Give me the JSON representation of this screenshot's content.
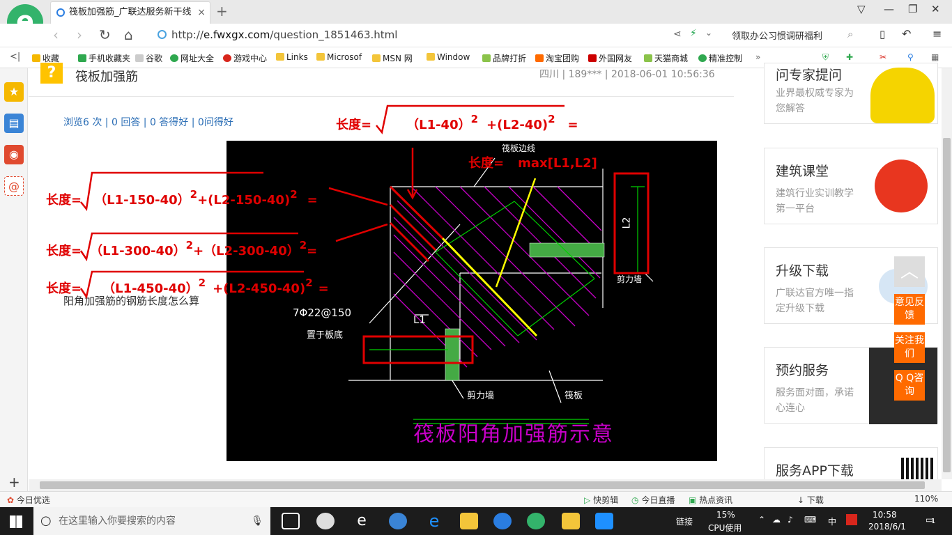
{
  "browser": {
    "tab_title": "筏板加强筋_广联达服务新干线",
    "url_scheme": "http://",
    "url_host": "e.fwxgx.com",
    "url_path": "/question_1851463.html",
    "promo_text": "领取办公习惯调研福利",
    "bookmarks": [
      "收藏",
      "手机收藏夹",
      "谷歌",
      "网址大全",
      "游戏中心",
      "Links",
      "Microsof",
      "MSN 网",
      "Window",
      "品牌打折",
      "淘宝团购",
      "外国网友",
      "天猫商城",
      "精准控制"
    ]
  },
  "page": {
    "title": "筏板加强筋",
    "meta": "四川 | 189*** | 2018-06-01 10:56:36",
    "stats": "浏览6 次 | 0 回答 | 0 答得好 | 0问得好",
    "question_text": "阳角加强筋的钢筋长度怎么算"
  },
  "annotations": {
    "len": "长度=",
    "f1": "（L1-40）",
    "f1b": "+(L2-40)",
    "eq": "=",
    "f2": "（L1-150-40）",
    "f2b": "+(L2-150-40)",
    "f3": "（L1-300-40）",
    "f3b": "+（L2-300-40）",
    "f4": "（L1-450-40）",
    "f4b": "+(L2-450-40)",
    "sq": "2",
    "max": "max[L1,L2]"
  },
  "drawing": {
    "raft_edge": "筏板边线",
    "rebar": "7Φ22@150",
    "bottom": "置于板底",
    "shear_wall": "剪力墙",
    "raft": "筏板",
    "l1": "L1",
    "l2": "L2",
    "caption": "筏板阳角加强筋示意"
  },
  "sidebar_cards": [
    {
      "title": "问专家提问",
      "sub": "业界最权威专家为您解答"
    },
    {
      "title": "建筑课堂",
      "sub": "建筑行业实训教学第一平台"
    },
    {
      "title": "升级下载",
      "sub": "广联达官方唯一指定升级下载"
    },
    {
      "title": "预约服务",
      "sub": "服务面对面，承诺心连心"
    },
    {
      "title": "服务APP下载",
      "sub": ""
    }
  ],
  "float_buttons": [
    "意见反馈",
    "关注我们",
    "Q Q咨询"
  ],
  "status": {
    "left": "今日优选",
    "items": [
      "快剪辑",
      "今日直播",
      "热点资讯",
      "下载"
    ],
    "zoom": "110%"
  },
  "taskbar": {
    "search_placeholder": "在这里输入你要搜索的内容",
    "tray_link": "链接",
    "cpu": "15%",
    "cpu_label": "CPU使用",
    "ime": "中",
    "time": "10:58",
    "date": "2018/6/1",
    "notif": "1"
  },
  "colors": {
    "accent_red": "#e00000",
    "brand_green": "#33b36b",
    "link_blue": "#2a6db5",
    "float_orange": "#ff6a00"
  }
}
